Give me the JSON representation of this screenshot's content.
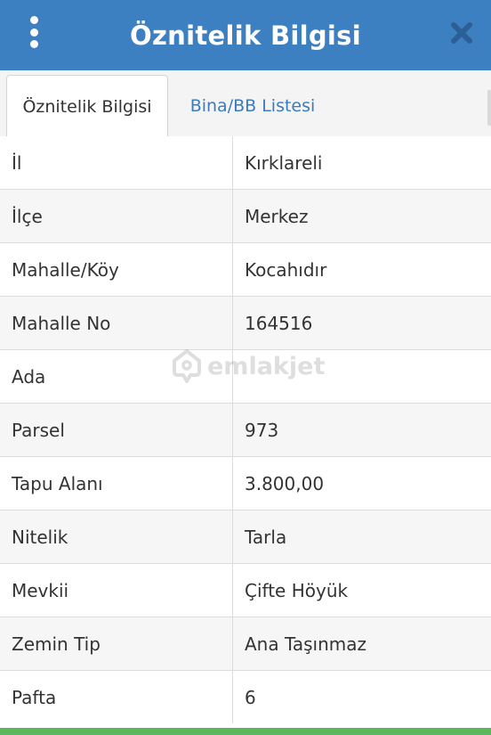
{
  "header": {
    "title": "Öznitelik Bilgisi",
    "menu_icon": "more-vertical-icon",
    "close_icon": "close-icon",
    "bg_color": "#3d80c2"
  },
  "tabs": [
    {
      "label": "Öznitelik Bilgisi",
      "active": true
    },
    {
      "label": "Bina/BB Listesi",
      "active": false
    }
  ],
  "attributes": [
    {
      "key": "İl",
      "value": "Kırklareli"
    },
    {
      "key": "İlçe",
      "value": "Merkez"
    },
    {
      "key": "Mahalle/Köy",
      "value": "Kocahıdır"
    },
    {
      "key": "Mahalle No",
      "value": "164516"
    },
    {
      "key": "Ada",
      "value": ""
    },
    {
      "key": "Parsel",
      "value": "973"
    },
    {
      "key": "Tapu Alanı",
      "value": "3.800,00"
    },
    {
      "key": "Nitelik",
      "value": "Tarla"
    },
    {
      "key": "Mevkii",
      "value": "Çifte Höyük"
    },
    {
      "key": "Zemin Tip",
      "value": "Ana Taşınmaz"
    },
    {
      "key": "Pafta",
      "value": "6"
    }
  ],
  "watermark": {
    "text": "emlakjet",
    "icon": "house-pin-icon"
  },
  "footer_color": "#5cb85c"
}
